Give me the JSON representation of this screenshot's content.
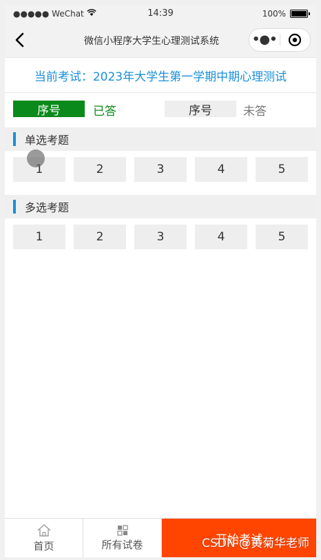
{
  "status": {
    "carrier": "●●●●● WeChat",
    "time": "14:39",
    "battery": "100%"
  },
  "nav": {
    "title": "微信小程序大学生心理测试系统",
    "menu_glyph": "•●•"
  },
  "exam": {
    "title": "当前考试：2023年大学生第一学期中期心理测试"
  },
  "legend": {
    "answered_chip": "序号",
    "answered_text": "已答",
    "unanswered_chip": "序号",
    "unanswered_text": "未答",
    "answered_color": "#0a8a1a"
  },
  "sections": {
    "single": {
      "label": "单选考题",
      "questions": [
        "1",
        "2",
        "3",
        "4",
        "5"
      ]
    },
    "multiple": {
      "label": "多选考题",
      "questions": [
        "1",
        "2",
        "3",
        "4",
        "5"
      ]
    }
  },
  "tabbar": {
    "home": "首页",
    "papers": "所有试卷",
    "start": "开始考试",
    "start_color": "#ff4500"
  },
  "watermark": "CSDN @黄菊华老师"
}
